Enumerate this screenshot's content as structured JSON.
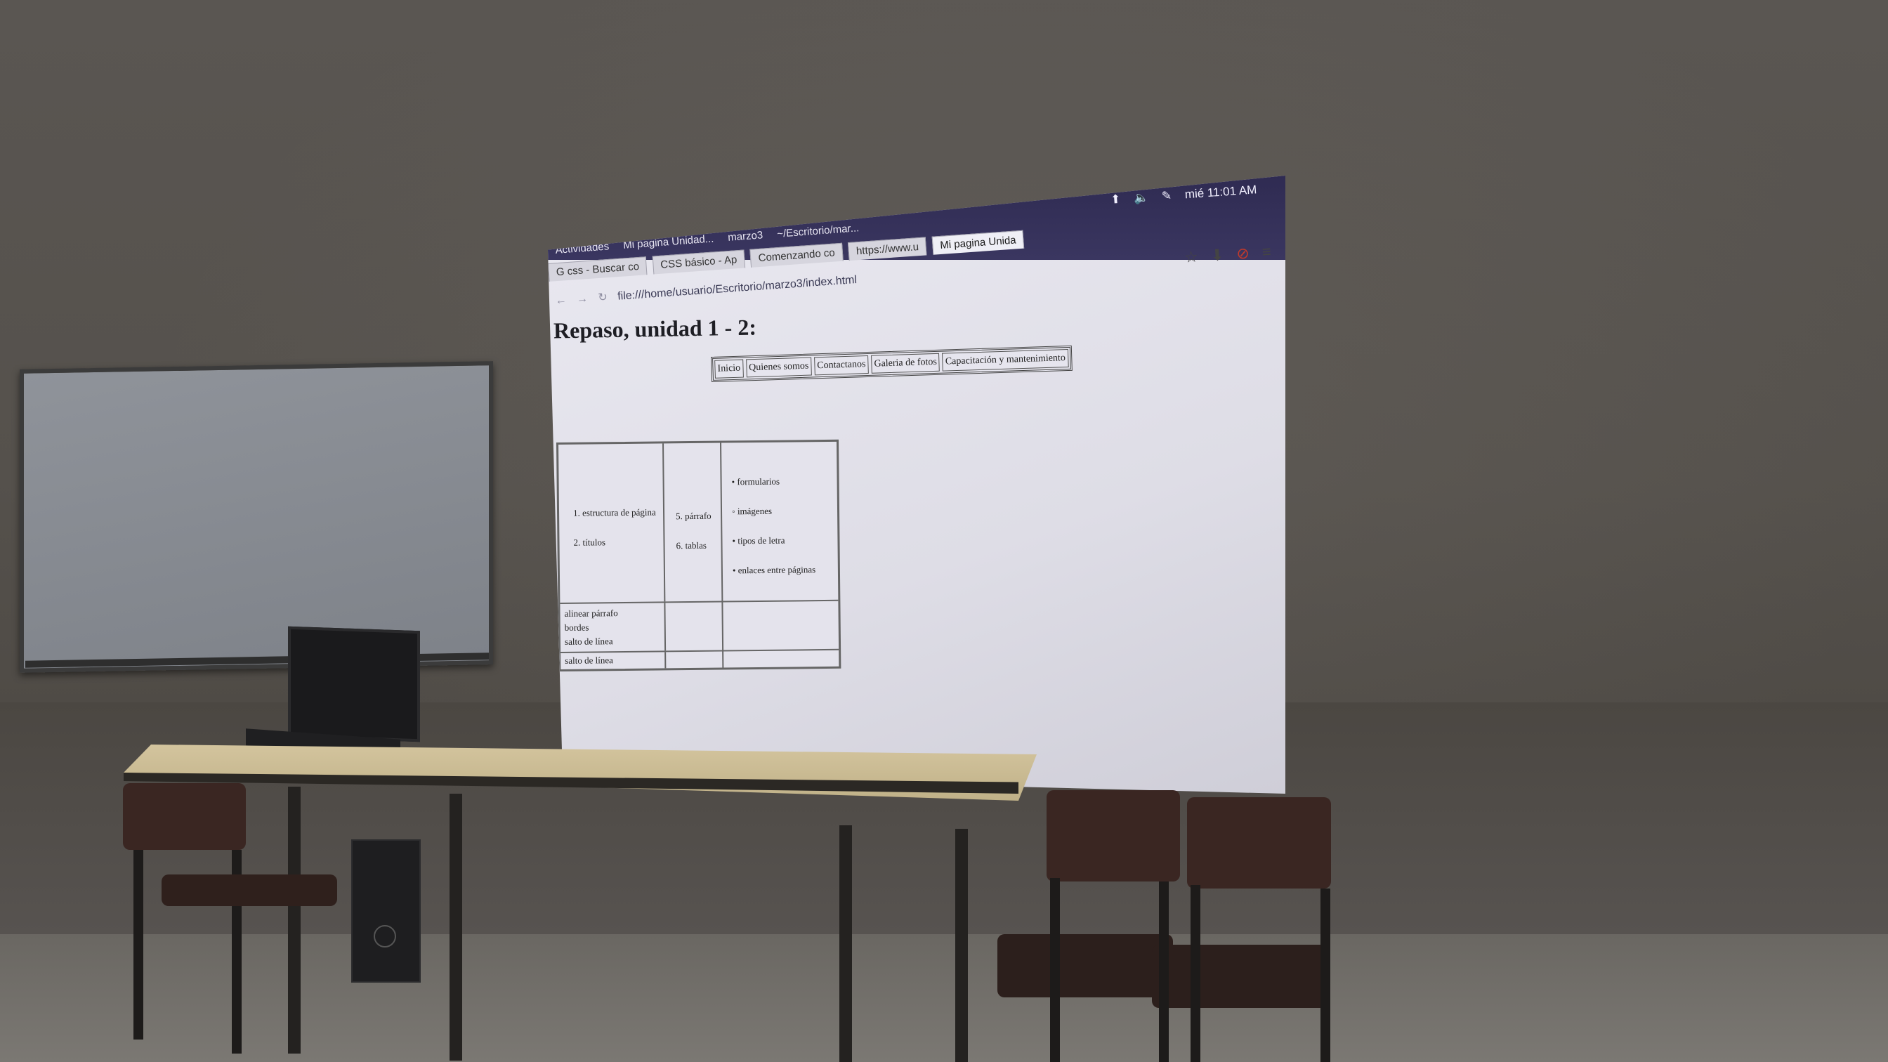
{
  "gnome": {
    "activities": "Actividades",
    "windows": [
      "Mi pagina Unidad...",
      "marzo3",
      "~/Escritorio/mar..."
    ],
    "clock": "mié 11:01 AM"
  },
  "browser": {
    "tabs": [
      "G css - Buscar co",
      "CSS básico - Ap",
      "Comenzando co",
      "https://www.u",
      "Mi pagina Unida"
    ],
    "url": "file:///home/usuario/Escritorio/marzo3/index.html"
  },
  "page": {
    "title": "Repaso, unidad 1 - 2:",
    "nav": [
      "Inicio",
      "Quienes somos",
      "Contactanos",
      "Galeria de fotos",
      "Capacitación y mantenimiento"
    ],
    "table": {
      "col1": [
        "1.   estructura de página",
        "2.   títulos"
      ],
      "col2": [
        "5.   párrafo",
        "6.   tablas"
      ],
      "col3": [
        "formularios",
        "imágenes",
        "tipos de letra",
        "enlaces entre páginas"
      ],
      "row2": [
        "alinear párrafo",
        "bordes",
        "salto de línea"
      ],
      "row3": "salto de línea"
    }
  },
  "icons": [
    "network-icon",
    "volume-icon",
    "pen-icon",
    "star-icon",
    "download-icon",
    "block-icon",
    "menu-icon"
  ]
}
